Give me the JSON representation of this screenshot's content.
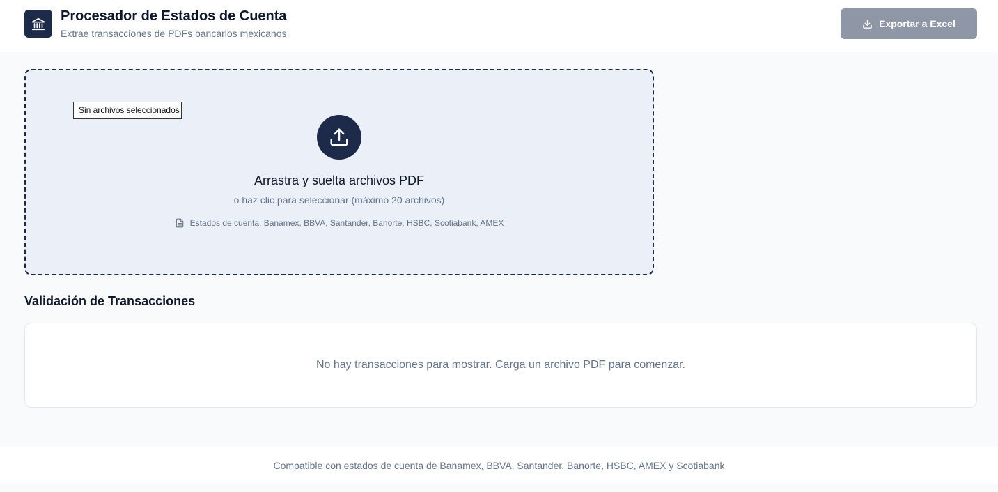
{
  "header": {
    "title": "Procesador de Estados de Cuenta",
    "subtitle": "Extrae transacciones de PDFs bancarios mexicanos",
    "logo_icon": "bank-icon",
    "export_button": {
      "label": "Exportar a Excel",
      "icon": "download-icon",
      "disabled": true
    }
  },
  "dropzone": {
    "file_input_text": "Sin archivos seleccionados",
    "upload_icon": "upload-icon",
    "title": "Arrastra y suelta archivos PDF",
    "subtitle": "o haz clic para seleccionar (máximo 20 archivos)",
    "supported_icon": "file-icon",
    "supported_text": "Estados de cuenta: Banamex, BBVA, Santander, Banorte, HSBC, Scotiabank, AMEX"
  },
  "validation": {
    "title": "Validación de Transacciones",
    "empty_message": "No hay transacciones para mostrar. Carga un archivo PDF para comenzar."
  },
  "footer": {
    "text": "Compatible con estados de cuenta de Banamex, BBVA, Santander, Banorte, HSBC, AMEX y Scotiabank"
  },
  "colors": {
    "primary": "#1e2a4a",
    "export_disabled": "#8f97a6",
    "dropzone_bg": "#eaeff8",
    "muted_text": "#64748b"
  }
}
